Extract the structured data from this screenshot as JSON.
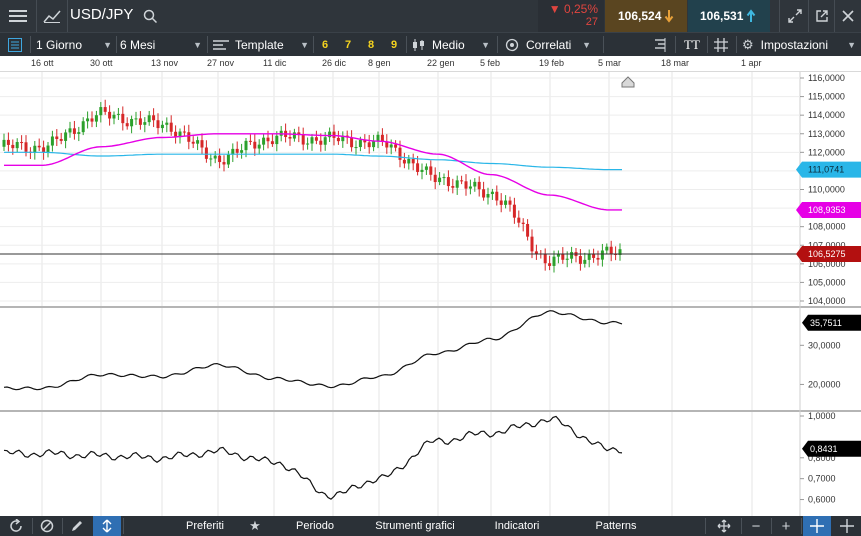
{
  "header": {
    "symbol": "USD/JPY",
    "change_pct": "▼ 0,25%",
    "change_abs": "27",
    "bid": "106,524",
    "ask": "106,531"
  },
  "toolbar": {
    "interval": "1 Giorno",
    "range": "6 Mesi",
    "template": "Template",
    "quick_periods": [
      "6",
      "7",
      "8",
      "9"
    ],
    "chart_style": "Medio",
    "correlated": "Correlati",
    "text_tool": "TT",
    "settings": "Impostazioni"
  },
  "dates": [
    "16 ott",
    "30 ott",
    "13 nov",
    "27 nov",
    "11 dic",
    "26 dic",
    "8 gen",
    "22 gen",
    "5 feb",
    "19 feb",
    "5 mar",
    "18 mar",
    "1 apr"
  ],
  "price_axis": [
    "116,0000",
    "115,0000",
    "114,0000",
    "113,0000",
    "112,0000",
    "111,0000",
    "110,0000",
    "109,0000",
    "108,0000",
    "107,0000",
    "106,0000",
    "105,0000",
    "104,0000"
  ],
  "price_tags": {
    "ma_long": "111,0741",
    "ma_short": "108,9353",
    "last": "106,5275"
  },
  "ind1_axis": [
    "30,0000",
    "20,0000"
  ],
  "ind1_tag": "35,7511",
  "ind2_axis": [
    "1,0000",
    "0,8000",
    "0,7000",
    "0,6000"
  ],
  "ind2_tag": "0,8431",
  "colors": {
    "up": "#2ca02c",
    "down": "#d62728",
    "ma_short": "#e600e6",
    "ma_long": "#29b6e8",
    "last": "#b31010",
    "header_bg": "#2f353b"
  },
  "bottom": {
    "favorites": "Preferiti",
    "period": "Periodo",
    "tools": "Strumenti grafici",
    "indicators": "Indicatori",
    "patterns": "Patterns"
  },
  "chart_data": {
    "type": "candlestick",
    "x": [
      "16 ott",
      "30 ott",
      "13 nov",
      "27 nov",
      "11 dic",
      "26 dic",
      "8 gen",
      "22 gen",
      "5 feb",
      "19 feb",
      "5 mar"
    ],
    "close": [
      112.3,
      114.0,
      113.5,
      111.7,
      112.8,
      112.7,
      112.5,
      110.6,
      109.8,
      106.2,
      106.53
    ],
    "ylim": [
      104,
      116
    ],
    "series": [
      {
        "values": [
          111.3,
          112.3,
          112.8,
          113.0,
          113.0,
          112.9,
          112.6,
          111.9,
          110.8,
          109.7,
          108.9
        ]
      },
      {
        "values": [
          112.0,
          111.8,
          111.9,
          111.9,
          111.9,
          111.9,
          111.8,
          111.6,
          111.4,
          111.2,
          111.07
        ]
      }
    ]
  },
  "chart_data_ind1": {
    "type": "line",
    "x": [
      "16 ott",
      "30 ott",
      "13 nov",
      "27 nov",
      "11 dic",
      "26 dic",
      "8 gen",
      "22 gen",
      "5 feb",
      "19 feb",
      "5 mar"
    ],
    "values": [
      19.0,
      22.5,
      22.0,
      25.0,
      21.5,
      19.5,
      22.0,
      28.0,
      31.5,
      38.5,
      35.75
    ],
    "ylim": [
      15,
      38
    ]
  },
  "chart_data_ind2": {
    "type": "line",
    "x": [
      "16 ott",
      "30 ott",
      "13 nov",
      "27 nov",
      "11 dic",
      "26 dic",
      "8 gen",
      "22 gen",
      "5 feb",
      "19 feb",
      "5 mar"
    ],
    "values": [
      0.82,
      0.81,
      0.8,
      0.83,
      0.78,
      0.62,
      0.7,
      0.88,
      0.92,
      0.98,
      0.843
    ],
    "ylim": [
      0.55,
      1.0
    ]
  }
}
